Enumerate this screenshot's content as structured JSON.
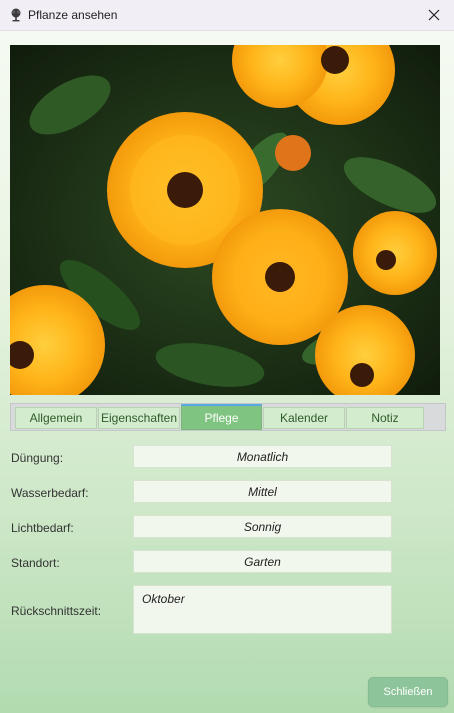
{
  "window": {
    "title": "Pflanze ansehen",
    "icon": "plant-icon",
    "close_icon": "close-icon"
  },
  "photo": {
    "subject": "orange calendula flowers"
  },
  "tabs": [
    {
      "label": "Allgemein",
      "active": false
    },
    {
      "label": "Eigenschaften",
      "active": false
    },
    {
      "label": "Pflege",
      "active": true
    },
    {
      "label": "Kalender",
      "active": false
    },
    {
      "label": "Notiz",
      "active": false
    }
  ],
  "care": {
    "fertilizing": {
      "label": "Düngung:",
      "value": "Monatlich"
    },
    "water": {
      "label": "Wasserbedarf:",
      "value": "Mittel"
    },
    "light": {
      "label": "Lichtbedarf:",
      "value": "Sonnig"
    },
    "location": {
      "label": "Standort:",
      "value": "Garten"
    },
    "pruning": {
      "label": "Rückschnittszeit:",
      "value": "Oktober"
    }
  },
  "footer": {
    "close_label": "Schließen"
  },
  "colors": {
    "active_tab": "#7fc481",
    "accent_blue": "#5aa7e6",
    "button": "#8dc49a"
  }
}
